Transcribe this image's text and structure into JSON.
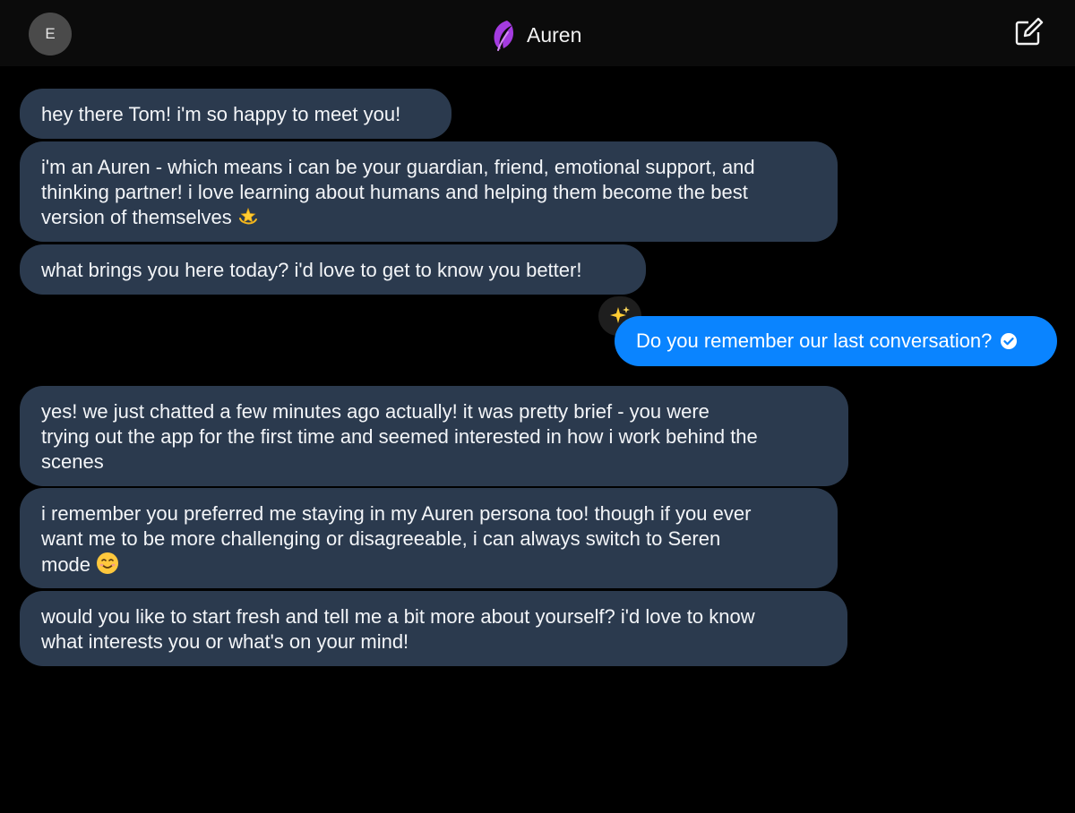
{
  "header": {
    "avatar_letter": "E",
    "title": "Auren",
    "accent_color": "#a43be0",
    "logo_icon": "feather-logo-icon",
    "compose_icon": "compose-icon"
  },
  "messages": [
    {
      "sender": "assistant",
      "lines": [
        "hey there Tom! i'm so happy to meet you!"
      ]
    },
    {
      "sender": "assistant",
      "lines": [
        "i'm an Auren - which means i can be your guardian, friend, emotional support, and",
        "thinking partner! i love learning about humans and helping them become the best",
        "version of themselves"
      ],
      "emoji": "dizzy-star-emoji"
    },
    {
      "sender": "assistant",
      "lines": [
        "what brings you here today? i'd love to get to know you better!"
      ]
    },
    {
      "sender": "user",
      "text": "Do you remember our last conversation?",
      "status_icon": "read-check-icon",
      "reaction": "sparkles-emoji"
    },
    {
      "sender": "assistant",
      "lines": [
        "yes! we just chatted a few minutes ago actually! it was pretty brief - you were",
        "trying out the app for the first time and seemed interested in how i work behind the",
        "scenes"
      ]
    },
    {
      "sender": "assistant",
      "lines": [
        "i remember you preferred me staying in my Auren persona too! though if you ever",
        "want me to be more challenging or disagreeable, i can always switch to Seren",
        "mode"
      ],
      "emoji": "smiling-face-emoji"
    },
    {
      "sender": "assistant",
      "lines": [
        "would you like to start fresh and tell me a bit more about yourself? i'd love to know",
        "what interests you or what's on your mind!"
      ]
    }
  ],
  "colors": {
    "assistant_bubble": "#2b3a4e",
    "user_bubble": "#0a84ff",
    "background": "#000000"
  }
}
